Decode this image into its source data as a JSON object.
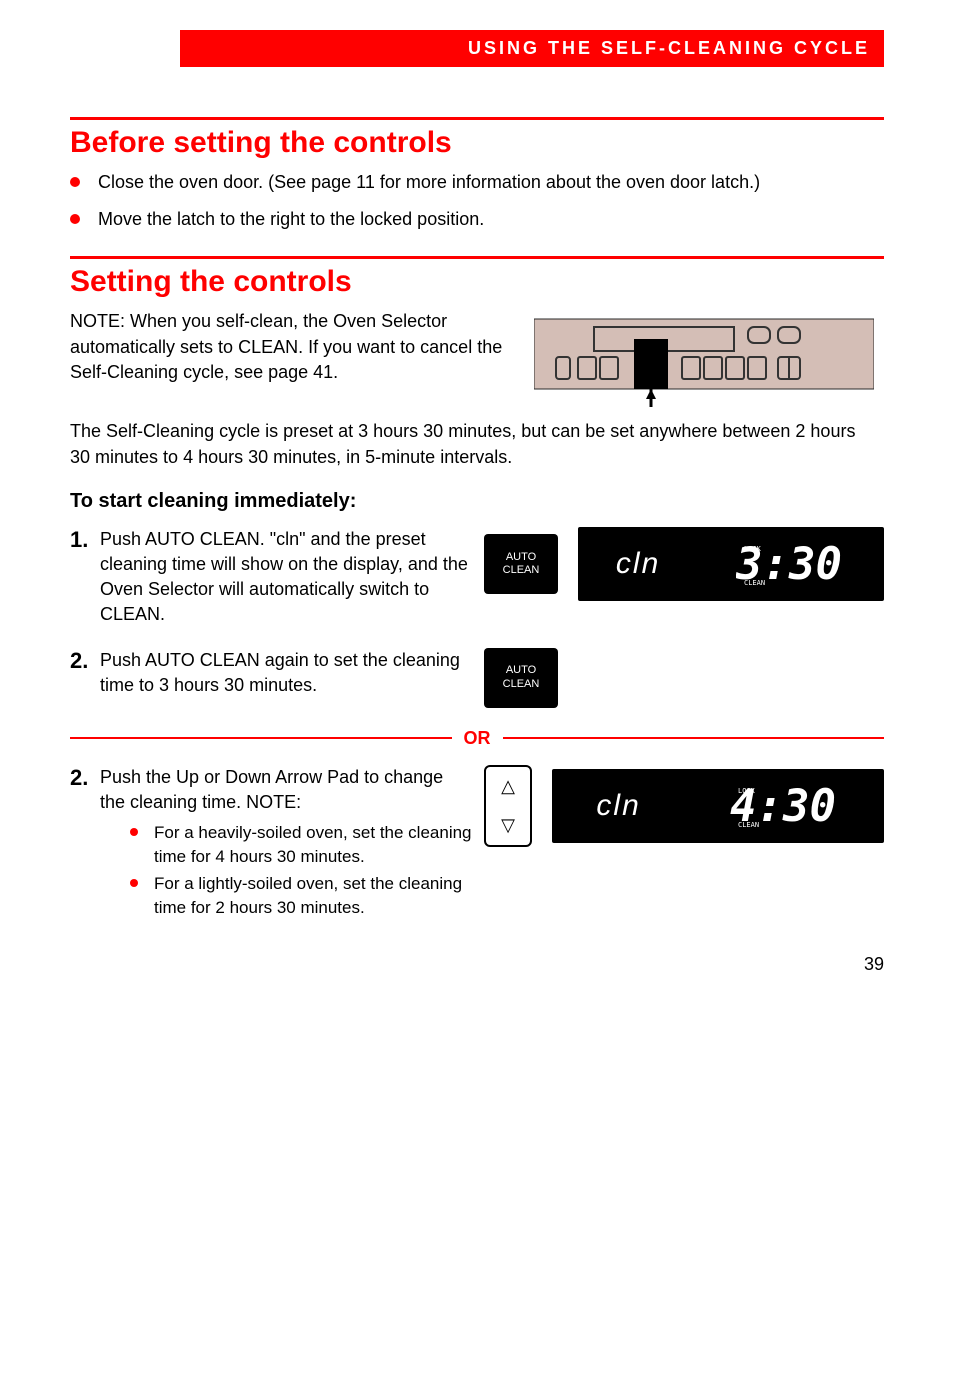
{
  "header": {
    "title": "USING THE SELF-CLEANING CYCLE"
  },
  "section1": {
    "heading": "Before setting the controls",
    "bullets": [
      "Close the oven door. (See page 11 for more information about the oven door latch.)",
      "Move the latch to the right to the locked position."
    ]
  },
  "section2": {
    "heading": "Setting the controls",
    "intro1": "NOTE: When you self-clean, the Oven Selector automatically sets to CLEAN. If you want to cancel the Self-Cleaning cycle, see page 41.",
    "intro2": "The Self-Cleaning cycle is preset at 3 hours 30 minutes, but can be set anywhere between 2 hours 30 minutes to 4 hours 30 minutes, in 5-minute intervals.",
    "subhead": "To start cleaning immediately:"
  },
  "steps": {
    "s1": {
      "num": "1.",
      "text": "Push AUTO CLEAN. \"cln\" and the preset cleaning time will show on the display, and the Oven Selector will automatically switch to CLEAN."
    },
    "s2a": {
      "num": "2.",
      "text": "Push AUTO CLEAN again to set the cleaning time to 3 hours 30 minutes."
    },
    "s2b": {
      "num": "2.",
      "text": "Push the Up or Down Arrow Pad to change the cleaning time. NOTE:"
    }
  },
  "buttons": {
    "auto_clean_top": "AUTO",
    "auto_clean_bot": "CLEAN"
  },
  "displays": {
    "d1": {
      "label": "cln",
      "time": "3:30"
    },
    "d2": {
      "label": "cln",
      "time": "4:30"
    }
  },
  "or_text": "OR",
  "note_bullets": [
    "For a heavily-soiled oven, set the cleaning time for 4 hours 30 minutes.",
    "For a lightly-soiled oven, set the cleaning time for 2 hours 30 minutes."
  ],
  "page_number": "39"
}
